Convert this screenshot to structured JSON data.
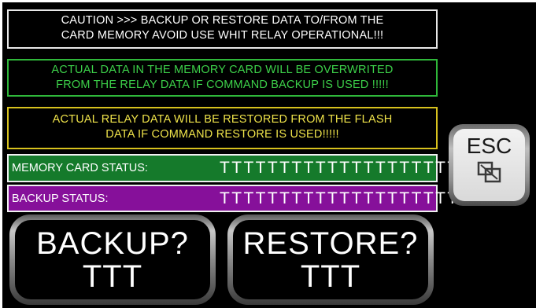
{
  "caution": {
    "line1": "CAUTION >>> BACKUP OR RESTORE DATA TO/FROM THE",
    "line2": "CARD MEMORY  AVOID USE WHIT RELAY OPERATIONAL!!!"
  },
  "backup_warning": {
    "line1": "ACTUAL DATA IN THE MEMORY CARD WILL BE OVERWRITED",
    "line2": "FROM THE RELAY DATA IF COMMAND BACKUP IS USED !!!!!"
  },
  "restore_warning": {
    "line1": "ACTUAL RELAY DATA WILL BE RESTORED FROM THE FLASH",
    "line2": "DATA IF COMMAND RESTORE IS USED!!!!!"
  },
  "memory_card_status": {
    "label": "MEMORY CARD STATUS:",
    "value": "TTTTTTTTTTTTTTTTTTTTT"
  },
  "backup_status": {
    "label": "BACKUP STATUS:",
    "value": "TTTTTTTTTTTTTTTTTTTTT"
  },
  "backup_button": {
    "label": "BACKUP?",
    "value": "TTT"
  },
  "restore_button": {
    "label": "RESTORE?",
    "value": "TTT"
  },
  "esc_button": {
    "label": "ESC",
    "icon": "window-restore-icon"
  },
  "colors": {
    "background": "#000000",
    "caution_border": "#e8e8e8",
    "backup_warning": "#3dd24a",
    "restore_warning": "#efe34a",
    "memory_card_status_bg": "#157a2b",
    "backup_status_bg": "#86109a"
  }
}
